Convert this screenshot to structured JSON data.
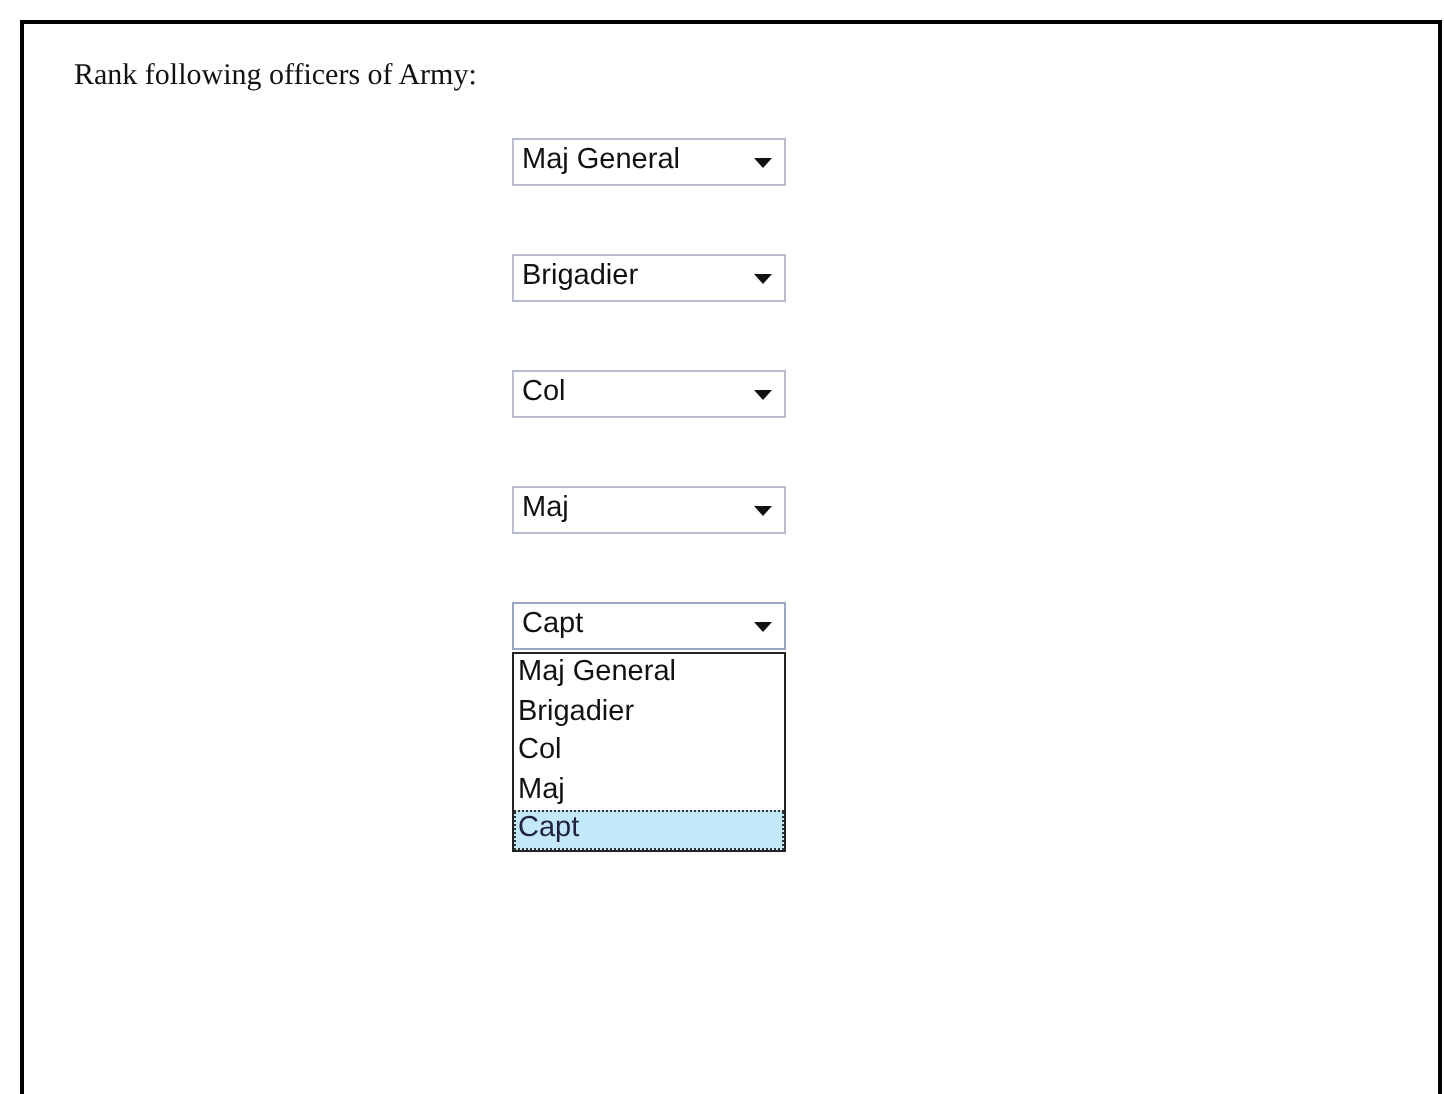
{
  "prompt": "Rank following officers of Army:",
  "selects": [
    {
      "value": "Maj General",
      "expanded": false
    },
    {
      "value": "Brigadier",
      "expanded": false
    },
    {
      "value": "Col",
      "expanded": false
    },
    {
      "value": "Maj",
      "expanded": false
    },
    {
      "value": "Capt",
      "expanded": true,
      "options": [
        {
          "label": "Maj General",
          "selected": false
        },
        {
          "label": "Brigadier",
          "selected": false
        },
        {
          "label": "Col",
          "selected": false
        },
        {
          "label": "Maj",
          "selected": false
        },
        {
          "label": "Capt",
          "selected": true
        }
      ]
    }
  ]
}
